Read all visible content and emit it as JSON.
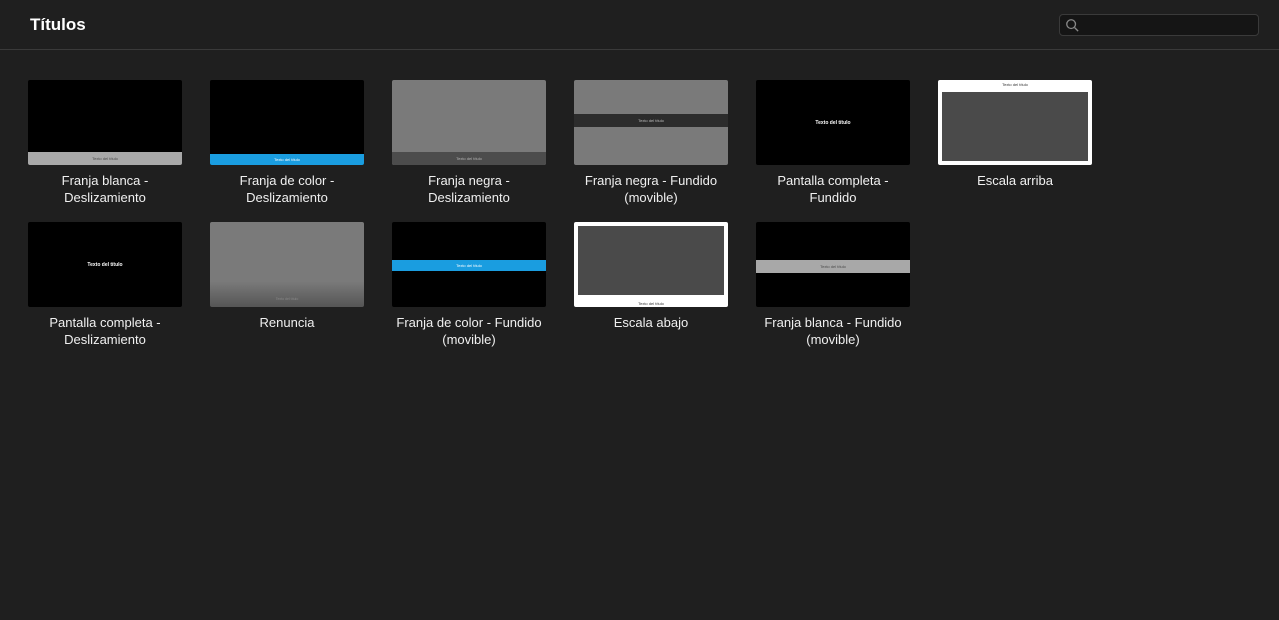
{
  "header": {
    "title": "Títulos",
    "search_placeholder": ""
  },
  "sample_text": "Texto del título",
  "tiles": [
    {
      "label": "Franja blanca - Deslizamiento"
    },
    {
      "label": "Franja de color - Deslizamiento"
    },
    {
      "label": "Franja negra - Deslizamiento"
    },
    {
      "label": "Franja negra - Fundido (movible)"
    },
    {
      "label": "Pantalla completa - Fundido"
    },
    {
      "label": "Escala arriba"
    },
    {
      "label": "Pantalla completa - Deslizamiento"
    },
    {
      "label": "Renuncia"
    },
    {
      "label": "Franja de color - Fundido (movible)"
    },
    {
      "label": "Escala abajo"
    },
    {
      "label": "Franja blanca - Fundido (movible)"
    }
  ]
}
